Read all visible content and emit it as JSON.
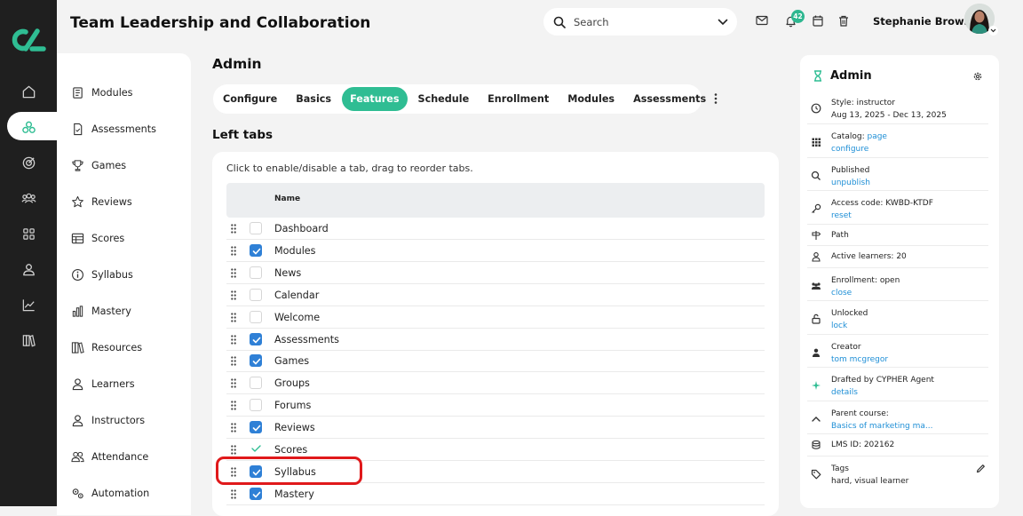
{
  "app": {
    "title": "Team Leadership and Collaboration"
  },
  "search": {
    "placeholder": "Search"
  },
  "notifications": {
    "count": "42"
  },
  "user": {
    "name": "Stephanie Brown"
  },
  "rail": {
    "items": [
      {
        "icon": "home-icon"
      },
      {
        "icon": "courses-icon",
        "active": true
      },
      {
        "icon": "target-icon"
      },
      {
        "icon": "people-icon"
      },
      {
        "icon": "grid-icon"
      },
      {
        "icon": "person-icon"
      },
      {
        "icon": "chart-icon"
      },
      {
        "icon": "library-icon"
      }
    ]
  },
  "sidebar": {
    "items": [
      {
        "label": "Modules",
        "icon": "modules-icon"
      },
      {
        "label": "Assessments",
        "icon": "assessment-icon"
      },
      {
        "label": "Games",
        "icon": "trophy-icon"
      },
      {
        "label": "Reviews",
        "icon": "star-icon"
      },
      {
        "label": "Scores",
        "icon": "table-icon"
      },
      {
        "label": "Syllabus",
        "icon": "info-icon"
      },
      {
        "label": "Mastery",
        "icon": "bar-chart-icon"
      },
      {
        "label": "Resources",
        "icon": "books-icon"
      },
      {
        "label": "Learners",
        "icon": "user-icon"
      },
      {
        "label": "Instructors",
        "icon": "user-icon"
      },
      {
        "label": "Attendance",
        "icon": "group-icon"
      },
      {
        "label": "Automation",
        "icon": "gears-icon"
      }
    ]
  },
  "main": {
    "title": "Admin",
    "tabs": [
      {
        "label": "Configure",
        "active": false
      },
      {
        "label": "Basics",
        "active": false
      },
      {
        "label": "Features",
        "active": true
      },
      {
        "label": "Schedule",
        "active": false
      },
      {
        "label": "Enrollment",
        "active": false
      },
      {
        "label": "Modules",
        "active": false
      },
      {
        "label": "Assessments",
        "active": false
      }
    ],
    "section_title": "Left tabs",
    "hint": "Click to enable/disable a tab, drag to reorder tabs.",
    "table": {
      "header": "Name",
      "rows": [
        {
          "name": "Dashboard",
          "state": "unchecked"
        },
        {
          "name": "Modules",
          "state": "checked"
        },
        {
          "name": "News",
          "state": "unchecked"
        },
        {
          "name": "Calendar",
          "state": "unchecked"
        },
        {
          "name": "Welcome",
          "state": "unchecked"
        },
        {
          "name": "Assessments",
          "state": "checked"
        },
        {
          "name": "Games",
          "state": "checked"
        },
        {
          "name": "Groups",
          "state": "unchecked"
        },
        {
          "name": "Forums",
          "state": "unchecked"
        },
        {
          "name": "Reviews",
          "state": "checked"
        },
        {
          "name": "Scores",
          "state": "locked"
        },
        {
          "name": "Syllabus",
          "state": "checked"
        },
        {
          "name": "Mastery",
          "state": "checked"
        }
      ]
    }
  },
  "panel": {
    "title": "Admin",
    "rows": [
      {
        "icon": "clock-icon",
        "line1": "Style: instructor",
        "line2": "Aug 13, 2025 - Dec 13, 2025",
        "line2_link": false
      },
      {
        "icon": "catalog-icon",
        "line1": "Catalog:",
        "line1_link": "page",
        "line2": "configure",
        "line2_link": true
      },
      {
        "icon": "search-icon",
        "line1": "Published",
        "line2": "unpublish",
        "line2_link": true
      },
      {
        "icon": "key-icon",
        "line1": "Access code: KWBD-KTDF",
        "line2": "reset",
        "line2_link": true
      },
      {
        "icon": "path-icon",
        "line1": "Path"
      },
      {
        "icon": "learner-icon",
        "line1": "Active learners: 20"
      },
      {
        "icon": "enrollment-icon",
        "line1": "Enrollment: open",
        "line2": "close",
        "line2_link": true
      },
      {
        "icon": "unlock-icon",
        "line1": "Unlocked",
        "line2": "lock",
        "line2_link": true
      },
      {
        "icon": "creator-icon",
        "line1": "Creator",
        "line2": "tom mcgregor",
        "line2_link": true
      },
      {
        "icon": "sparkle-icon",
        "line1": "Drafted by CYPHER Agent",
        "line2": "details",
        "line2_link": true
      },
      {
        "icon": "chevron-up-icon",
        "line1": "Parent course:",
        "line2": "Basics of marketing ma...",
        "line2_link": true
      },
      {
        "icon": "database-icon",
        "line1": "LMS ID: 202162"
      },
      {
        "icon": "tag-icon",
        "line1": "Tags",
        "line2": "hard, visual learner",
        "line2_link": false
      }
    ]
  },
  "colors": {
    "accent": "#2fbd93",
    "checkbox": "#2f80d6",
    "link": "#1f8fd6",
    "rail": "#1f1f1f",
    "highlight": "#e0191b"
  }
}
